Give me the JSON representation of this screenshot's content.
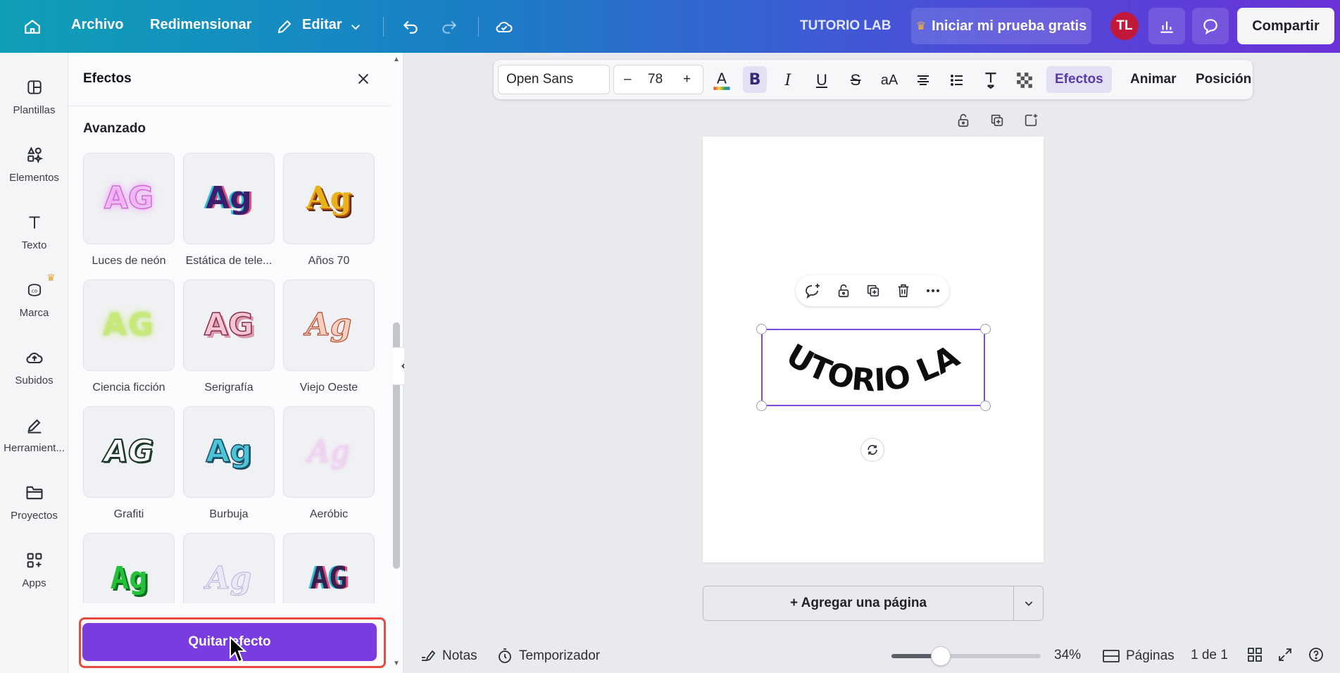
{
  "topbar": {
    "menu": [
      "Archivo",
      "Redimensionar",
      "Editar"
    ],
    "project_name": "TUTORIO LAB",
    "trial_label": "Iniciar mi prueba gratis",
    "avatar_initials": "TL",
    "share_label": "Compartir"
  },
  "rail": [
    {
      "label": "Plantillas",
      "icon": "templates-icon"
    },
    {
      "label": "Elementos",
      "icon": "elements-icon"
    },
    {
      "label": "Texto",
      "icon": "text-icon"
    },
    {
      "label": "Marca",
      "icon": "brand-icon"
    },
    {
      "label": "Subidos",
      "icon": "uploads-icon"
    },
    {
      "label": "Herramient...",
      "icon": "tools-icon"
    },
    {
      "label": "Proyectos",
      "icon": "projects-icon"
    },
    {
      "label": "Apps",
      "icon": "apps-icon"
    }
  ],
  "panel": {
    "title": "Efectos",
    "section": "Avanzado",
    "effects": [
      {
        "label": "Luces de neón",
        "sample": "AG"
      },
      {
        "label": "Estática de tele...",
        "sample": "Ag"
      },
      {
        "label": "Años 70",
        "sample": "Ag"
      },
      {
        "label": "Ciencia ficción",
        "sample": "AG"
      },
      {
        "label": "Serigrafía",
        "sample": "AG"
      },
      {
        "label": "Viejo Oeste",
        "sample": "Ag"
      },
      {
        "label": "Grafiti",
        "sample": "AG"
      },
      {
        "label": "Burbuja",
        "sample": "Ag"
      },
      {
        "label": "Aeróbic",
        "sample": "Ag"
      },
      {
        "label": "",
        "sample": "Ag"
      },
      {
        "label": "",
        "sample": "Ag"
      },
      {
        "label": "",
        "sample": "AG"
      }
    ],
    "remove_label": "Quitar efecto"
  },
  "text_toolbar": {
    "font": "Open Sans",
    "minus": "–",
    "size": "78",
    "plus": "+",
    "effects_label": "Efectos",
    "animate_label": "Animar",
    "position_label": "Posición"
  },
  "canvas": {
    "text": "TUTORIO LAB",
    "add_page_label": "+ Agregar una página"
  },
  "bottom": {
    "notes_label": "Notas",
    "timer_label": "Temporizador",
    "zoom": "34%",
    "zoom_level": 0.34,
    "pages_label": "Páginas",
    "page_count": "1 de 1"
  },
  "colors": {
    "accent": "#7a3ce0",
    "highlight": "#e84a3f",
    "selection": "#7d4ae0",
    "avatar": "#c2193a"
  }
}
